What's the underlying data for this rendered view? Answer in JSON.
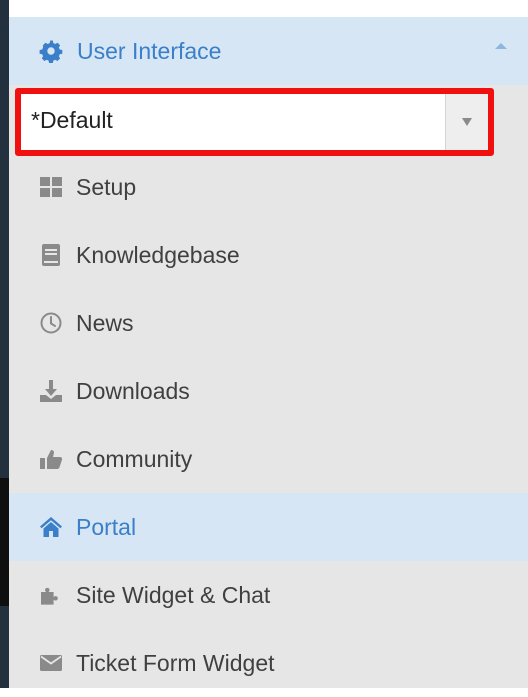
{
  "section": {
    "title": "User Interface",
    "icon": "gear-icon"
  },
  "interface_select": {
    "value": "*Default"
  },
  "menu": {
    "items": [
      {
        "label": "Setup",
        "icon": "grid-icon",
        "active": false
      },
      {
        "label": "Knowledgebase",
        "icon": "book-icon",
        "active": false
      },
      {
        "label": "News",
        "icon": "clock-icon",
        "active": false
      },
      {
        "label": "Downloads",
        "icon": "download-icon",
        "active": false
      },
      {
        "label": "Community",
        "icon": "thumbs-up-icon",
        "active": false
      },
      {
        "label": "Portal",
        "icon": "home-icon",
        "active": true
      },
      {
        "label": "Site Widget & Chat",
        "icon": "puzzle-icon",
        "active": false
      },
      {
        "label": "Ticket Form Widget",
        "icon": "envelope-icon",
        "active": false
      }
    ]
  },
  "colors": {
    "active_text": "#3a7fc8",
    "active_background": "#d7e6f5",
    "menu_background": "#e6e6e6",
    "highlight_border": "#f01010",
    "icon_gray": "#8a8a8a"
  }
}
